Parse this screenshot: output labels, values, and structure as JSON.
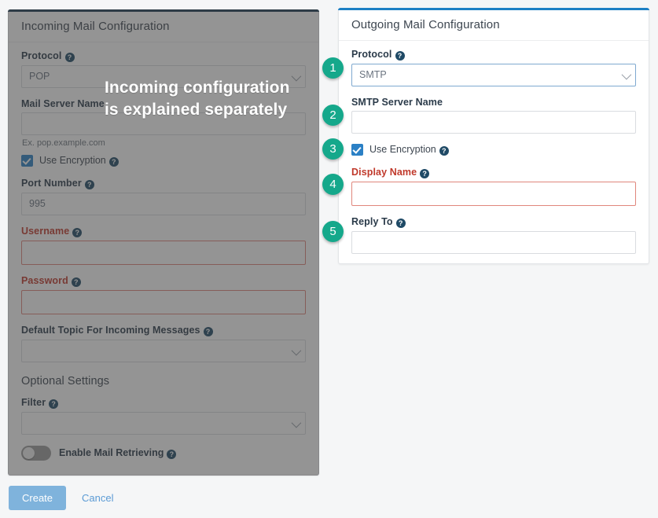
{
  "incoming": {
    "title": "Incoming Mail Configuration",
    "overlay_note": "Incoming configuration is explained separately",
    "top_accent": "#1b3a52",
    "fields": {
      "protocol_label": "Protocol",
      "protocol_value": "POP",
      "mail_server_label": "Mail Server Name",
      "mail_server_value": "",
      "mail_server_hint": "Ex. pop.example.com",
      "use_encryption_label": "Use Encryption",
      "port_label": "Port Number",
      "port_value": "995",
      "username_label": "Username",
      "username_value": "",
      "password_label": "Password",
      "password_value": "",
      "default_topic_label": "Default Topic For Incoming Messages",
      "default_topic_value": ""
    },
    "optional": {
      "section_title": "Optional Settings",
      "filter_label": "Filter",
      "filter_value": "",
      "enable_retrieving_label": "Enable Mail Retrieving"
    }
  },
  "outgoing": {
    "title": "Outgoing Mail Configuration",
    "top_accent": "#1d80c4",
    "fields": {
      "protocol_label": "Protocol",
      "protocol_value": "SMTP",
      "smtp_server_label": "SMTP Server Name",
      "smtp_server_value": "",
      "use_encryption_label": "Use Encryption",
      "display_name_label": "Display Name",
      "display_name_value": "",
      "reply_to_label": "Reply To",
      "reply_to_value": ""
    }
  },
  "footer": {
    "create_label": "Create",
    "cancel_label": "Cancel"
  },
  "badges": [
    {
      "number": "1"
    },
    {
      "number": "2"
    },
    {
      "number": "3"
    },
    {
      "number": "4"
    },
    {
      "number": "5"
    }
  ],
  "icons": {
    "help": "?"
  },
  "colors": {
    "badge": "#15a88b",
    "error": "#c0392b",
    "primary": "#2b80c5",
    "create_button": "#7fb3dc"
  }
}
